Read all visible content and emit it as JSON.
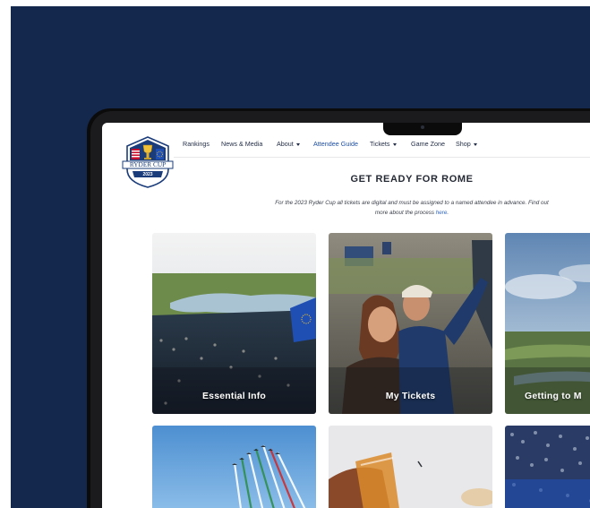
{
  "nav": {
    "items": [
      {
        "label": "Rankings",
        "dropdown": false,
        "active": false
      },
      {
        "label": "News & Media",
        "dropdown": false,
        "active": false
      },
      {
        "label": "About",
        "dropdown": true,
        "active": false
      },
      {
        "label": "Attendee Guide",
        "dropdown": false,
        "active": true
      },
      {
        "label": "Tickets",
        "dropdown": true,
        "active": false
      },
      {
        "label": "Game Zone",
        "dropdown": false,
        "active": false
      },
      {
        "label": "Shop",
        "dropdown": true,
        "active": false
      }
    ]
  },
  "logo": {
    "text": "RYDER CUP",
    "year": "2023"
  },
  "page": {
    "heading": "GET READY FOR ROME",
    "intro_text": "For the 2023 Ryder Cup all tickets are digital and must be assigned to a named attendee in advance. Find out more about the process ",
    "intro_link": "here",
    "intro_end": "."
  },
  "cards": [
    {
      "label": "Essential Info"
    },
    {
      "label": "My Tickets"
    },
    {
      "label": "Getting to M"
    }
  ],
  "colors": {
    "background": "#14284d",
    "link": "#2b63c6",
    "active_nav": "#1d4fa3"
  }
}
